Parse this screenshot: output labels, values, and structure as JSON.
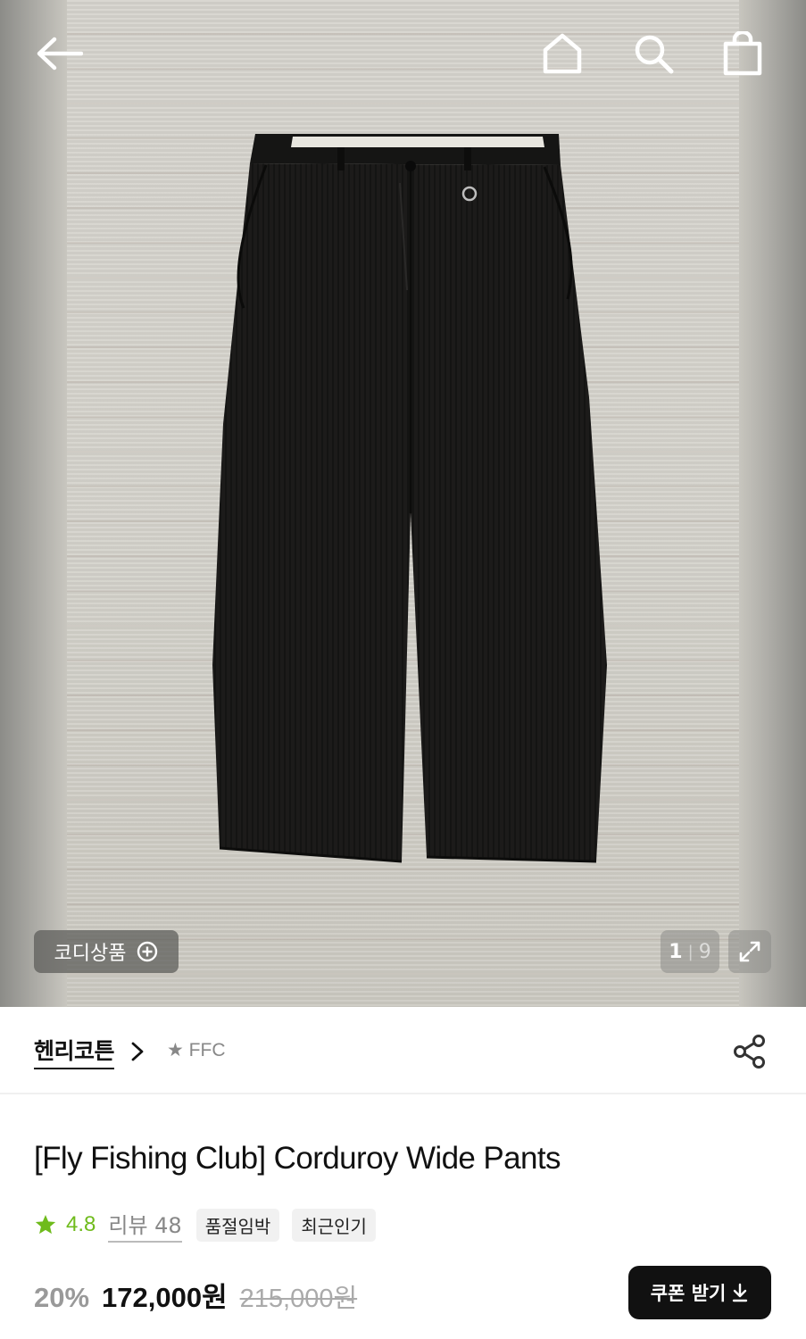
{
  "gallery": {
    "codi_label": "코디상품",
    "current": "1",
    "separator": "|",
    "total": "9"
  },
  "brand": {
    "name": "헨리코튼",
    "sub_brand": "★ FFC"
  },
  "product": {
    "title": "[Fly Fishing Club] Corduroy Wide Pants",
    "rating": "4.8",
    "review_label": "리뷰 48",
    "tags": [
      "품절임박",
      "최근인기"
    ],
    "discount": "20%",
    "price": "172,000원",
    "original_price": "215,000원",
    "coupon_label": "쿠폰 받기"
  },
  "icons": {
    "back": "arrow-left-icon",
    "home": "home-icon",
    "search": "search-icon",
    "bag": "shopping-bag-icon",
    "plus_circle": "plus-circle-icon",
    "expand": "expand-icon",
    "chevron": "chevron-right-icon",
    "share": "share-icon",
    "star": "star-icon",
    "download": "download-icon"
  },
  "colors": {
    "rating_green": "#6fbb1c",
    "coupon_bg": "#111111",
    "discount_gray": "#999999"
  }
}
